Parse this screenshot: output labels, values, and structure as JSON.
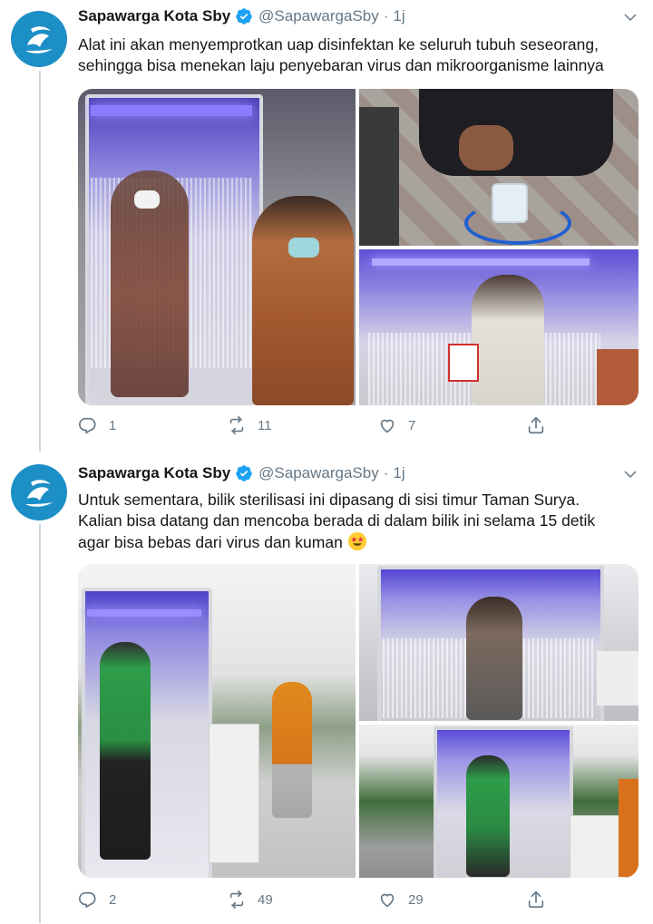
{
  "tweets": [
    {
      "author": "Sapawarga Kota Sby",
      "handle": "@SapawargaSby",
      "separator": "·",
      "time": "1j",
      "text_line1": "Alat ini akan menyemprotkan uap disinfektan ke seluruh tubuh seseorang,",
      "text_line2": "sehingga bisa menekan laju penyebaran virus dan mikroorganisme lainnya",
      "replies": "1",
      "retweets": "11",
      "likes": "7"
    },
    {
      "author": "Sapawarga Kota Sby",
      "handle": "@SapawargaSby",
      "separator": "·",
      "time": "1j",
      "text_line1": "Untuk sementara, bilik sterilisasi ini dipasang di sisi timur Taman Surya.",
      "text_line2": "Kalian bisa datang dan mencoba berada di dalam bilik ini selama 15 detik",
      "text_line3": "agar bisa bebas dari virus dan kuman",
      "replies": "2",
      "retweets": "49",
      "likes": "29"
    }
  ],
  "colors": {
    "verified": "#1da1f2",
    "avatar": "#1c8fc6",
    "muted": "#657786",
    "booth_light": "#7b61ff"
  }
}
